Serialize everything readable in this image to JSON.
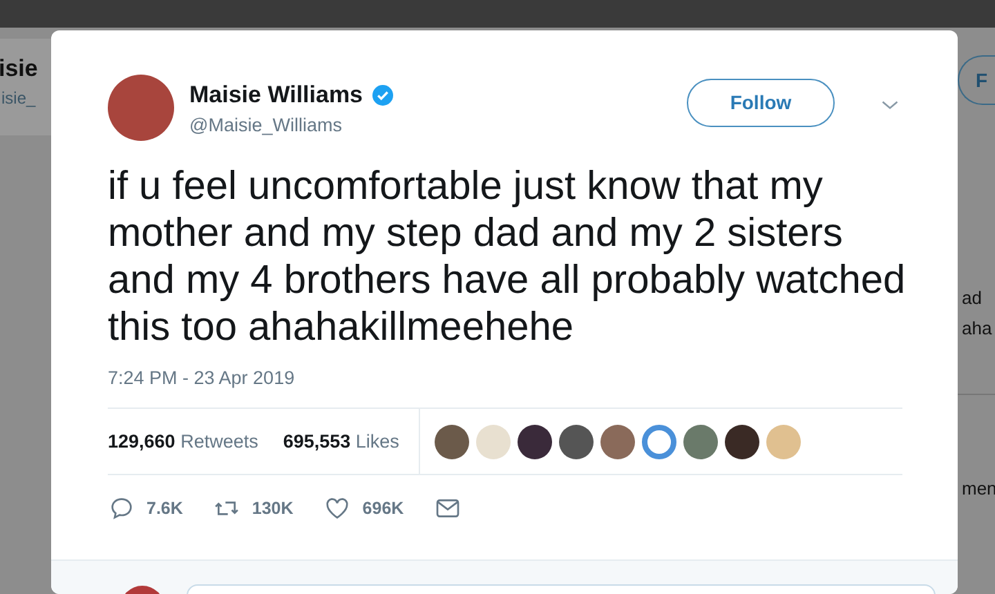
{
  "background_page": {
    "left_name": "isie",
    "left_handle": "isie_",
    "right_button": "F",
    "right_text_lines": [
      "ad",
      "aha",
      "men"
    ]
  },
  "tweet": {
    "author": {
      "name": "Maisie Williams",
      "handle": "@Maisie_Williams",
      "verified": true
    },
    "follow_button": "Follow",
    "text": "if u feel uncomfortable just know that my mother and my step dad and my 2 sisters and my 4 brothers have all probably watched this too ahahakillmeehehe",
    "timestamp": "7:24 PM - 23 Apr 2019",
    "stats": [
      {
        "count": "129,660",
        "label": "Retweets"
      },
      {
        "count": "695,553",
        "label": "Likes"
      }
    ],
    "actions": [
      {
        "kind": "reply",
        "count": "7.6K"
      },
      {
        "kind": "retweet",
        "count": "130K"
      },
      {
        "kind": "like",
        "count": "696K"
      },
      {
        "kind": "message"
      }
    ]
  }
}
